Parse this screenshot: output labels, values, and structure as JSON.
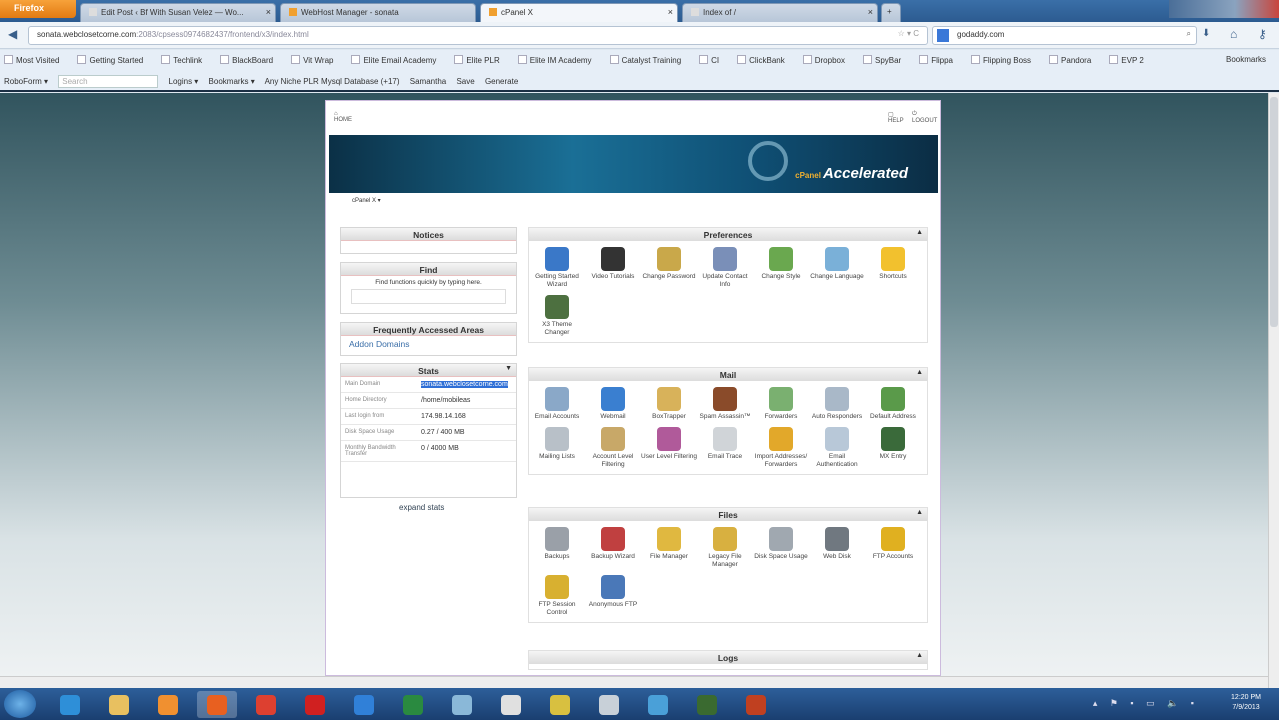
{
  "browser": {
    "menu_label": "Firefox",
    "tabs": [
      {
        "label": "Edit Post ‹ Bf With Susan Velez — Wo...",
        "active": false
      },
      {
        "label": "WebHost Manager - sonata",
        "active": false
      },
      {
        "label": "cPanel X",
        "active": true
      },
      {
        "label": "Index of /",
        "active": false
      }
    ],
    "new_tab": "+",
    "url_domain": "sonata.webclosetcorne.com",
    "url_path": ":2083/cpsess0974682437/frontend/x3/index.html",
    "search_value": "godaddy.com",
    "bookmarks": [
      "Most Visited",
      "Getting Started",
      "Techlink",
      "BlackBoard",
      "Vit Wrap",
      "Elite Email Academy",
      "Elite PLR",
      "Elite IM Academy",
      "Catalyst Training",
      "CI",
      "ClickBank",
      "Dropbox",
      "SpyBar",
      "Flippa",
      "Flipping Boss",
      "Pandora",
      "EVP 2"
    ],
    "bookmarks_menu": "Bookmarks",
    "toolbar2": {
      "roboform": "RoboForm ▾",
      "search_placeholder": "Search",
      "logins": "Logins ▾",
      "bookmarks": "Bookmarks ▾",
      "database": "Any Niche PLR Mysql Database (+17)",
      "samantha": "Samantha",
      "save": "Save",
      "generate": "Generate"
    }
  },
  "cpanel": {
    "help": "HELP",
    "logout": "LOGOUT",
    "home": "HOME",
    "banner_brand": "cPanel",
    "banner_text": "Accelerated",
    "theme_select": "cPanel X ▾",
    "notices_title": "Notices",
    "find_title": "Find",
    "find_hint": "Find functions quickly by typing here.",
    "faa_title": "Frequently Accessed Areas",
    "faa_link": "Addon Domains",
    "stats_title": "Stats",
    "stats": [
      {
        "label": "Main Domain",
        "value": "sonata.webclosetcorne.com"
      },
      {
        "label": "Home Directory",
        "value": "/home/mobileas"
      },
      {
        "label": "Last login from",
        "value": "174.98.14.168"
      },
      {
        "label": "Disk Space Usage",
        "value": "0.27 / 400 MB"
      },
      {
        "label": "Monthly Bandwidth Transfer",
        "value": "0 / 4000 MB"
      }
    ],
    "expand_stats": "expand stats",
    "sections": [
      {
        "title": "Preferences",
        "items": [
          {
            "label": "Getting Started Wizard",
            "color": "#3a78c8"
          },
          {
            "label": "Video Tutorials",
            "color": "#333"
          },
          {
            "label": "Change Password",
            "color": "#c9a84a"
          },
          {
            "label": "Update Contact Info",
            "color": "#7a8fb8"
          },
          {
            "label": "Change Style",
            "color": "#6aa84f"
          },
          {
            "label": "Change Language",
            "color": "#7ab0d8"
          },
          {
            "label": "Shortcuts",
            "color": "#f2c12e"
          },
          {
            "label": "X3 Theme Changer",
            "color": "#4d7040"
          }
        ]
      },
      {
        "title": "Mail",
        "items": [
          {
            "label": "Email Accounts",
            "color": "#8aa8c8"
          },
          {
            "label": "Webmail",
            "color": "#3a7fd0"
          },
          {
            "label": "BoxTrapper",
            "color": "#d8b25a"
          },
          {
            "label": "Spam Assassin™",
            "color": "#8a4b2a"
          },
          {
            "label": "Forwarders",
            "color": "#7ab070"
          },
          {
            "label": "Auto Responders",
            "color": "#a9b8c8"
          },
          {
            "label": "Default Address",
            "color": "#5a9a4a"
          },
          {
            "label": "Mailing Lists",
            "color": "#b8c0c8"
          },
          {
            "label": "Account Level Filtering",
            "color": "#c8a868"
          },
          {
            "label": "User Level Filtering",
            "color": "#b05a9a"
          },
          {
            "label": "Email Trace",
            "color": "#d0d4d8"
          },
          {
            "label": "Import Addresses/ Forwarders",
            "color": "#e2a82a"
          },
          {
            "label": "Email Authentication",
            "color": "#b8c8d8"
          },
          {
            "label": "MX Entry",
            "color": "#3a6a3a"
          }
        ]
      },
      {
        "title": "Files",
        "items": [
          {
            "label": "Backups",
            "color": "#9aa0a8"
          },
          {
            "label": "Backup Wizard",
            "color": "#c04040"
          },
          {
            "label": "File Manager",
            "color": "#e0b840"
          },
          {
            "label": "Legacy File Manager",
            "color": "#d8b040"
          },
          {
            "label": "Disk Space Usage",
            "color": "#a0a8b0"
          },
          {
            "label": "Web Disk",
            "color": "#707880"
          },
          {
            "label": "FTP Accounts",
            "color": "#e0b020"
          },
          {
            "label": "FTP Session Control",
            "color": "#d8b030"
          },
          {
            "label": "Anonymous FTP",
            "color": "#4a78b8"
          }
        ]
      },
      {
        "title": "Logs",
        "items": []
      }
    ]
  },
  "taskbar": {
    "time": "12:20 PM",
    "date": "7/9/2013",
    "apps": [
      {
        "name": "internet-explorer",
        "color": "#2e8fd8"
      },
      {
        "name": "file-explorer",
        "color": "#e8c060"
      },
      {
        "name": "media-player",
        "color": "#f09030"
      },
      {
        "name": "firefox",
        "color": "#e86020"
      },
      {
        "name": "chrome",
        "color": "#dd4030"
      },
      {
        "name": "acrobat",
        "color": "#d02020"
      },
      {
        "name": "dropbox",
        "color": "#3080d8"
      },
      {
        "name": "excel",
        "color": "#2a8a40"
      },
      {
        "name": "explorer-window",
        "color": "#8ab8d8"
      },
      {
        "name": "notepad",
        "color": "#e0e0e0"
      },
      {
        "name": "pen-tool",
        "color": "#d8c040"
      },
      {
        "name": "document",
        "color": "#c8d0d8"
      },
      {
        "name": "remote-desktop",
        "color": "#4aa0d8"
      },
      {
        "name": "camtasia",
        "color": "#3a6a30"
      },
      {
        "name": "recorder",
        "color": "#c04020"
      }
    ]
  }
}
